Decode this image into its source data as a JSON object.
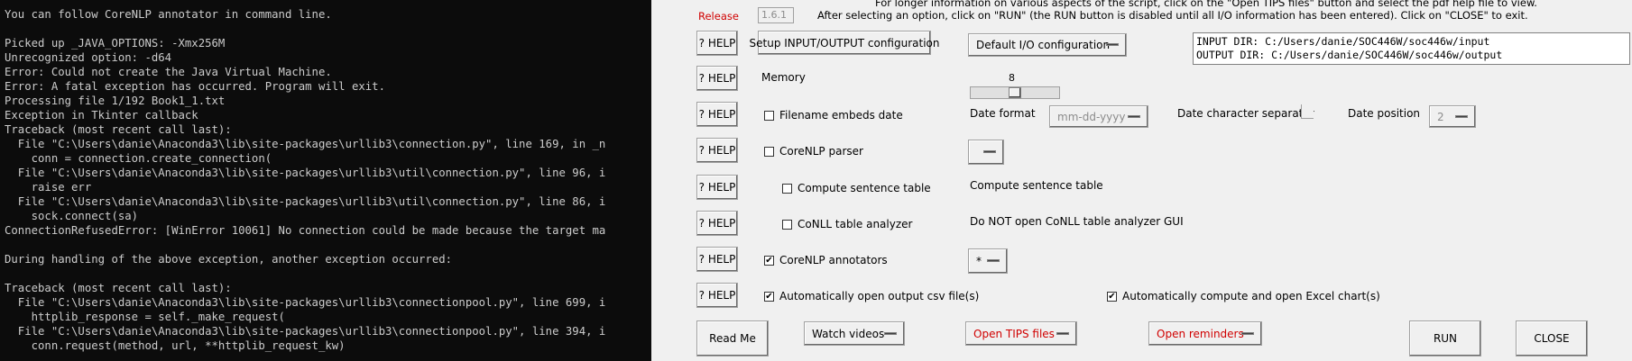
{
  "console": {
    "lines": [
      "You can follow CoreNLP annotator in command line.",
      "",
      "Picked up _JAVA_OPTIONS: -Xmx256M",
      "Unrecognized option: -d64",
      "Error: Could not create the Java Virtual Machine.",
      "Error: A fatal exception has occurred. Program will exit.",
      "Processing file 1/192 Book1_1.txt",
      "Exception in Tkinter callback",
      "Traceback (most recent call last):",
      "  File \"C:\\Users\\danie\\Anaconda3\\lib\\site-packages\\urllib3\\connection.py\", line 169, in _n",
      "    conn = connection.create_connection(",
      "  File \"C:\\Users\\danie\\Anaconda3\\lib\\site-packages\\urllib3\\util\\connection.py\", line 96, i",
      "    raise err",
      "  File \"C:\\Users\\danie\\Anaconda3\\lib\\site-packages\\urllib3\\util\\connection.py\", line 86, i",
      "    sock.connect(sa)",
      "ConnectionRefusedError: [WinError 10061] No connection could be made because the target ma",
      "",
      "During handling of the above exception, another exception occurred:",
      "",
      "Traceback (most recent call last):",
      "  File \"C:\\Users\\danie\\Anaconda3\\lib\\site-packages\\urllib3\\connectionpool.py\", line 699, i",
      "    httplib_response = self._make_request(",
      "  File \"C:\\Users\\danie\\Anaconda3\\lib\\site-packages\\urllib3\\connectionpool.py\", line 394, i",
      "    conn.request(method, url, **httplib_request_kw)"
    ]
  },
  "header": {
    "info_top": "For longer information on various aspects of the script, click on the \"Open TIPS files\" button and select the pdf help file to view.",
    "release_label": "Release",
    "release_value": "1.6.1",
    "info_line": "After selecting an option, click on \"RUN\" (the RUN button is disabled until all I/O information has been entered).   Click on \"CLOSE\" to exit."
  },
  "help_label": "? HELP",
  "io": {
    "setup_button": "Setup INPUT/OUTPUT configuration",
    "config_menu": "Default I/O configuration",
    "input_dir": "INPUT DIR: C:/Users/danie/SOC446W/soc446w/input",
    "output_dir": "OUTPUT DIR: C:/Users/danie/SOC446W/soc446w/output"
  },
  "memory": {
    "label": "Memory",
    "value": "8",
    "fraction": 0.5
  },
  "date": {
    "filename_embeds_label": "Filename embeds date",
    "format_label": "Date format",
    "format_value": "mm-dd-yyyy",
    "separator_label": "Date character separator",
    "position_label": "Date position",
    "position_value": "2"
  },
  "corenlp_parser": {
    "label": "CoreNLP parser",
    "menu_value": ""
  },
  "sentence_table": {
    "label": "Compute sentence table",
    "status": "Compute sentence table"
  },
  "conll": {
    "label": "CoNLL table analyzer",
    "status": "Do NOT open CoNLL table analyzer GUI"
  },
  "annotators": {
    "label": "CoreNLP annotators",
    "menu_value": "*"
  },
  "output_opts": {
    "csv_label": "Automatically open output csv file(s)",
    "excel_label": "Automatically compute and open Excel chart(s)"
  },
  "footer": {
    "read_me": "Read Me",
    "watch_videos": "Watch videos",
    "tips": "Open TIPS files",
    "reminders": "Open reminders",
    "run": "RUN",
    "close": "CLOSE"
  },
  "colors": {
    "accent_red": "#d00000",
    "console_bg": "#0c0c0c",
    "console_text": "#cccccc"
  }
}
